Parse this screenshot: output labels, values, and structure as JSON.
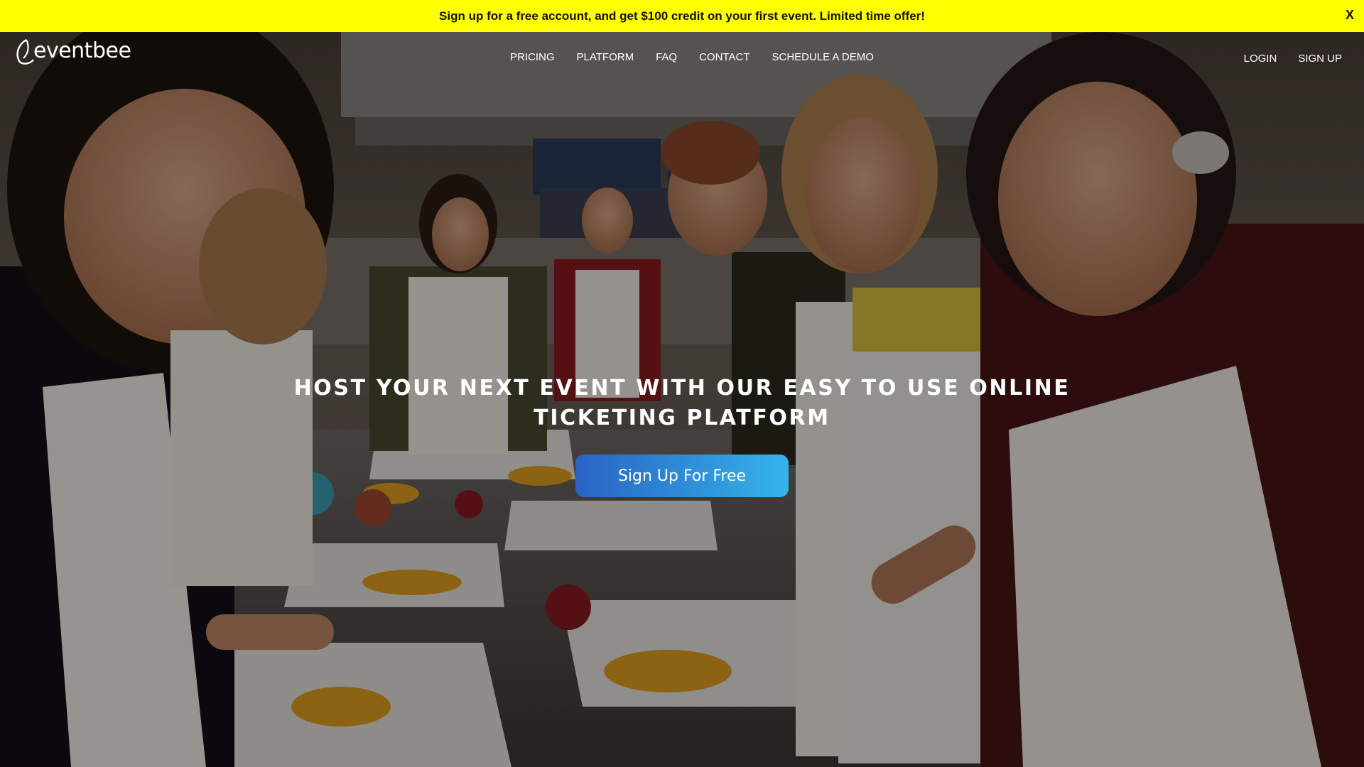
{
  "promo_banner": {
    "text": "Sign up for a free account, and get $100 credit on your first event. Limited time offer!",
    "close_label": "X",
    "background": "#ffff00"
  },
  "header": {
    "logo_text": "eventbee",
    "nav": [
      {
        "label": "PRICING"
      },
      {
        "label": "PLATFORM"
      },
      {
        "label": "FAQ"
      },
      {
        "label": "CONTACT"
      },
      {
        "label": "SCHEDULE A DEMO"
      }
    ],
    "account": [
      {
        "label": "LOGIN"
      },
      {
        "label": "SIGN UP"
      }
    ]
  },
  "hero": {
    "headline_line1": "HOST YOUR NEXT EVENT WITH OUR EASY TO USE ONLINE",
    "headline_line2": "TICKETING PLATFORM",
    "cta_label": "Sign Up For Free",
    "cta_colors": [
      "#2a63c4",
      "#36b4ea"
    ],
    "background_image": "cooking-class-photo"
  }
}
